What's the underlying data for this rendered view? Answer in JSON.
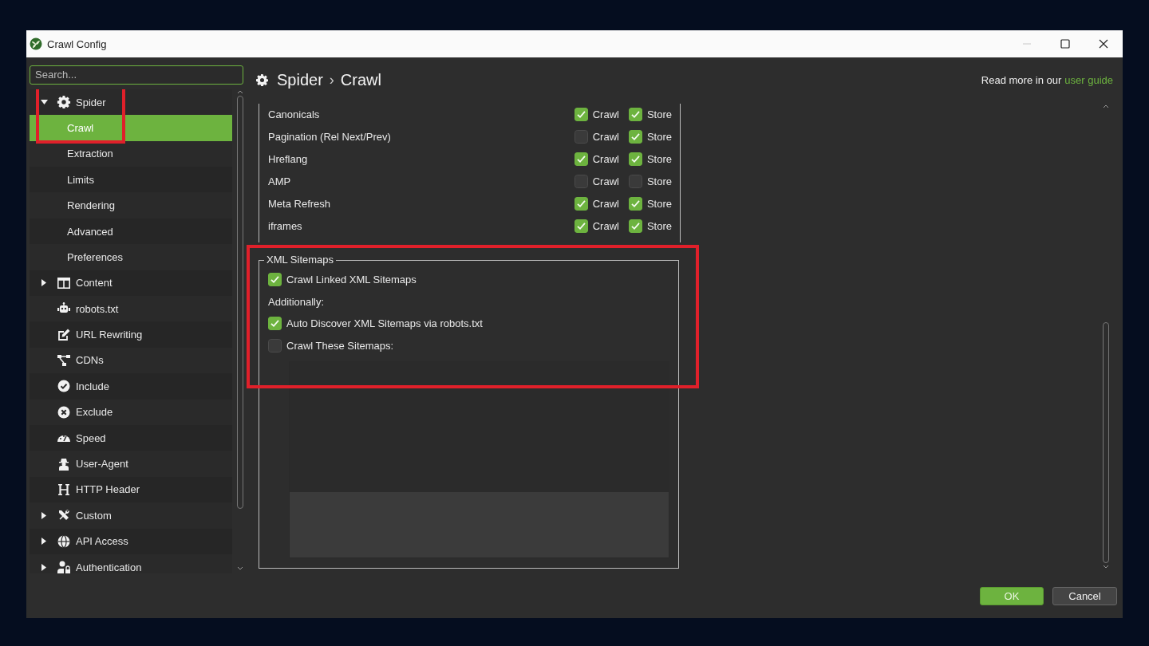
{
  "window": {
    "title": "Crawl Config"
  },
  "sidebar": {
    "search": {
      "placeholder": "Search..."
    },
    "items": [
      {
        "label": "Spider",
        "expanded": true,
        "selected": false,
        "highlighted": true,
        "children": [
          {
            "label": "Crawl",
            "selected": true
          },
          {
            "label": "Extraction",
            "selected": false
          },
          {
            "label": "Limits",
            "selected": false
          },
          {
            "label": "Rendering",
            "selected": false
          },
          {
            "label": "Advanced",
            "selected": false
          },
          {
            "label": "Preferences",
            "selected": false
          }
        ]
      },
      {
        "label": "Content",
        "expanded": false,
        "selected": false
      },
      {
        "label": "robots.txt",
        "selected": false
      },
      {
        "label": "URL Rewriting",
        "selected": false
      },
      {
        "label": "CDNs",
        "selected": false
      },
      {
        "label": "Include",
        "selected": false
      },
      {
        "label": "Exclude",
        "selected": false
      },
      {
        "label": "Speed",
        "selected": false
      },
      {
        "label": "User-Agent",
        "selected": false
      },
      {
        "label": "HTTP Header",
        "selected": false
      },
      {
        "label": "Custom",
        "expanded": false,
        "selected": false
      },
      {
        "label": "API Access",
        "expanded": false,
        "selected": false
      },
      {
        "label": "Authentication",
        "expanded": false,
        "selected": false
      }
    ]
  },
  "header": {
    "breadcrumb": [
      "Spider",
      "Crawl"
    ],
    "separator": "›",
    "help_text": "Read more in our",
    "help_link": "user guide"
  },
  "link_rows": [
    {
      "label": "Canonicals",
      "crawl": {
        "label": "Crawl",
        "checked": true
      },
      "store": {
        "label": "Store",
        "checked": true
      }
    },
    {
      "label": "Pagination (Rel Next/Prev)",
      "crawl": {
        "label": "Crawl",
        "checked": false
      },
      "store": {
        "label": "Store",
        "checked": true
      }
    },
    {
      "label": "Hreflang",
      "crawl": {
        "label": "Crawl",
        "checked": true
      },
      "store": {
        "label": "Store",
        "checked": true
      }
    },
    {
      "label": "AMP",
      "crawl": {
        "label": "Crawl",
        "checked": false
      },
      "store": {
        "label": "Store",
        "checked": false
      }
    },
    {
      "label": "Meta Refresh",
      "crawl": {
        "label": "Crawl",
        "checked": true
      },
      "store": {
        "label": "Store",
        "checked": true
      }
    },
    {
      "label": "iframes",
      "crawl": {
        "label": "Crawl",
        "checked": true
      },
      "store": {
        "label": "Store",
        "checked": true
      }
    }
  ],
  "xml_sitemaps": {
    "title": "XML Sitemaps",
    "highlighted": true,
    "items": [
      {
        "kind": "checkbox",
        "label": "Crawl Linked XML Sitemaps",
        "checked": true
      },
      {
        "kind": "text",
        "label": "Additionally:"
      },
      {
        "kind": "checkbox",
        "label": "Auto Discover XML Sitemaps via robots.txt",
        "checked": true
      },
      {
        "kind": "checkbox",
        "label": "Crawl These Sitemaps:",
        "checked": false
      },
      {
        "kind": "text-area",
        "disabled": true
      }
    ]
  },
  "buttons": [
    {
      "label": "OK",
      "kind": "primary"
    },
    {
      "label": "Cancel",
      "kind": "secondary"
    }
  ]
}
